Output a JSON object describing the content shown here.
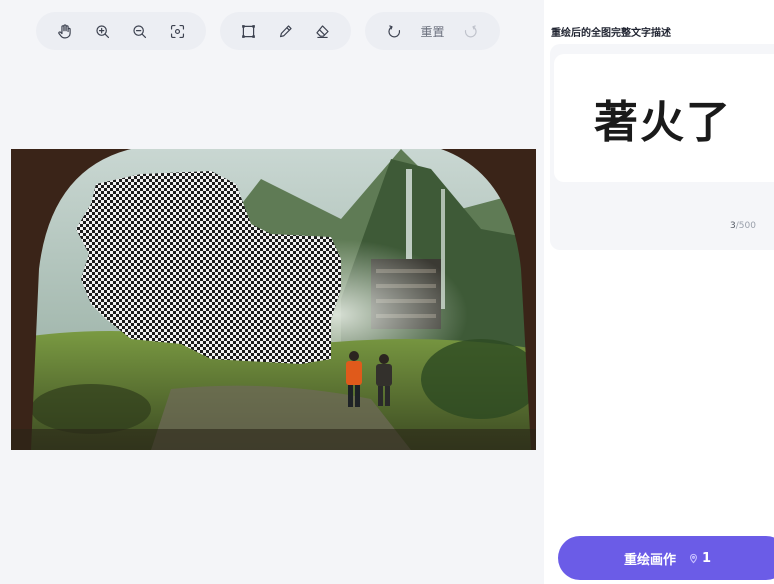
{
  "toolbar": {
    "pan_icon": "hand-icon",
    "zoom_in_icon": "zoom-in-icon",
    "zoom_out_icon": "zoom-out-icon",
    "fit_icon": "fit-screen-icon",
    "select_icon": "rect-select-icon",
    "brush_icon": "brush-icon",
    "eraser_icon": "eraser-icon",
    "undo_icon": "undo-icon",
    "reset_label": "重置",
    "redo_icon": "redo-icon"
  },
  "panel": {
    "title": "重绘后的全图完整文字描述",
    "prompt_value": "著火了",
    "char_count_current": "3",
    "char_count_max": "/500"
  },
  "submit": {
    "label": "重绘画作",
    "cost": "1"
  },
  "colors": {
    "accent": "#6b5ce7",
    "canvas_bg": "#f4f5f8"
  }
}
